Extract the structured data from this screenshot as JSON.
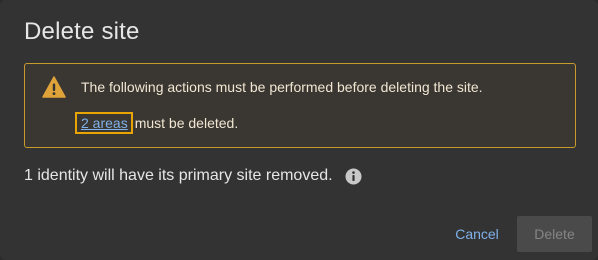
{
  "dialog": {
    "title": "Delete site",
    "warning": {
      "icon": "warning-icon",
      "message": "The following actions must be performed before deleting the site.",
      "areas_link": "2 areas",
      "areas_rest": "must be deleted."
    },
    "identity_notice": "1 identity will have its primary site removed.",
    "info_icon": "info-icon",
    "cancel_label": "Cancel",
    "delete_label": "Delete"
  },
  "colors": {
    "background": "#333333",
    "warning_border": "#c79a2c",
    "warning_icon": "#e0a33a",
    "link": "#7fb1ea",
    "focus_ring": "#e8a400",
    "disabled_button": "#4a4a4a"
  }
}
